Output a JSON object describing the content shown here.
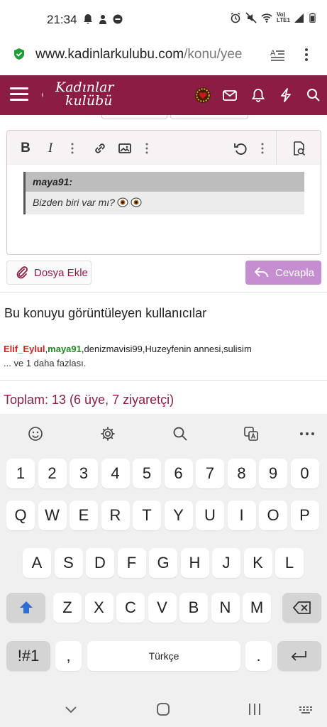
{
  "status": {
    "time": "21:34",
    "network": "Vo) LTE1"
  },
  "url": {
    "domain": "www.kadinlarkulubu.com",
    "path": "/konu/yee"
  },
  "site": {
    "logo_line1": "Kadınlar",
    "logo_line2": "kulübü"
  },
  "quote": {
    "author": "maya91:",
    "text": "Bizden biri var mı?"
  },
  "buttons": {
    "attach": "Dosya Ekle",
    "reply": "Cevapla"
  },
  "viewers": {
    "title": "Bu konuyu görüntüleyen kullanıcılar",
    "user1": "Elif_Eylul",
    "user2": "maya91",
    "others": "denizmavisi99,Huzeyfenin annesi,sulisim",
    "more": "... ve 1 daha fazlası."
  },
  "total": "Toplam: 13 (6 üye, 7 ziyaretçi)",
  "keyboard": {
    "row_numbers": [
      "1",
      "2",
      "3",
      "4",
      "5",
      "6",
      "7",
      "8",
      "9",
      "0"
    ],
    "row1": [
      "Q",
      "W",
      "E",
      "R",
      "T",
      "Y",
      "U",
      "I",
      "O",
      "P"
    ],
    "row2": [
      "A",
      "S",
      "D",
      "F",
      "G",
      "H",
      "J",
      "K",
      "L"
    ],
    "row3": [
      "Z",
      "X",
      "C",
      "V",
      "B",
      "N",
      "M"
    ],
    "symbols": "!#1",
    "comma": ",",
    "space": "Türkçe",
    "period": "."
  },
  "colors": {
    "brand": "#8b1d44",
    "reply_button": "#c58ed0",
    "user_red": "#d81e1e",
    "user_green": "#1f8a1f"
  }
}
